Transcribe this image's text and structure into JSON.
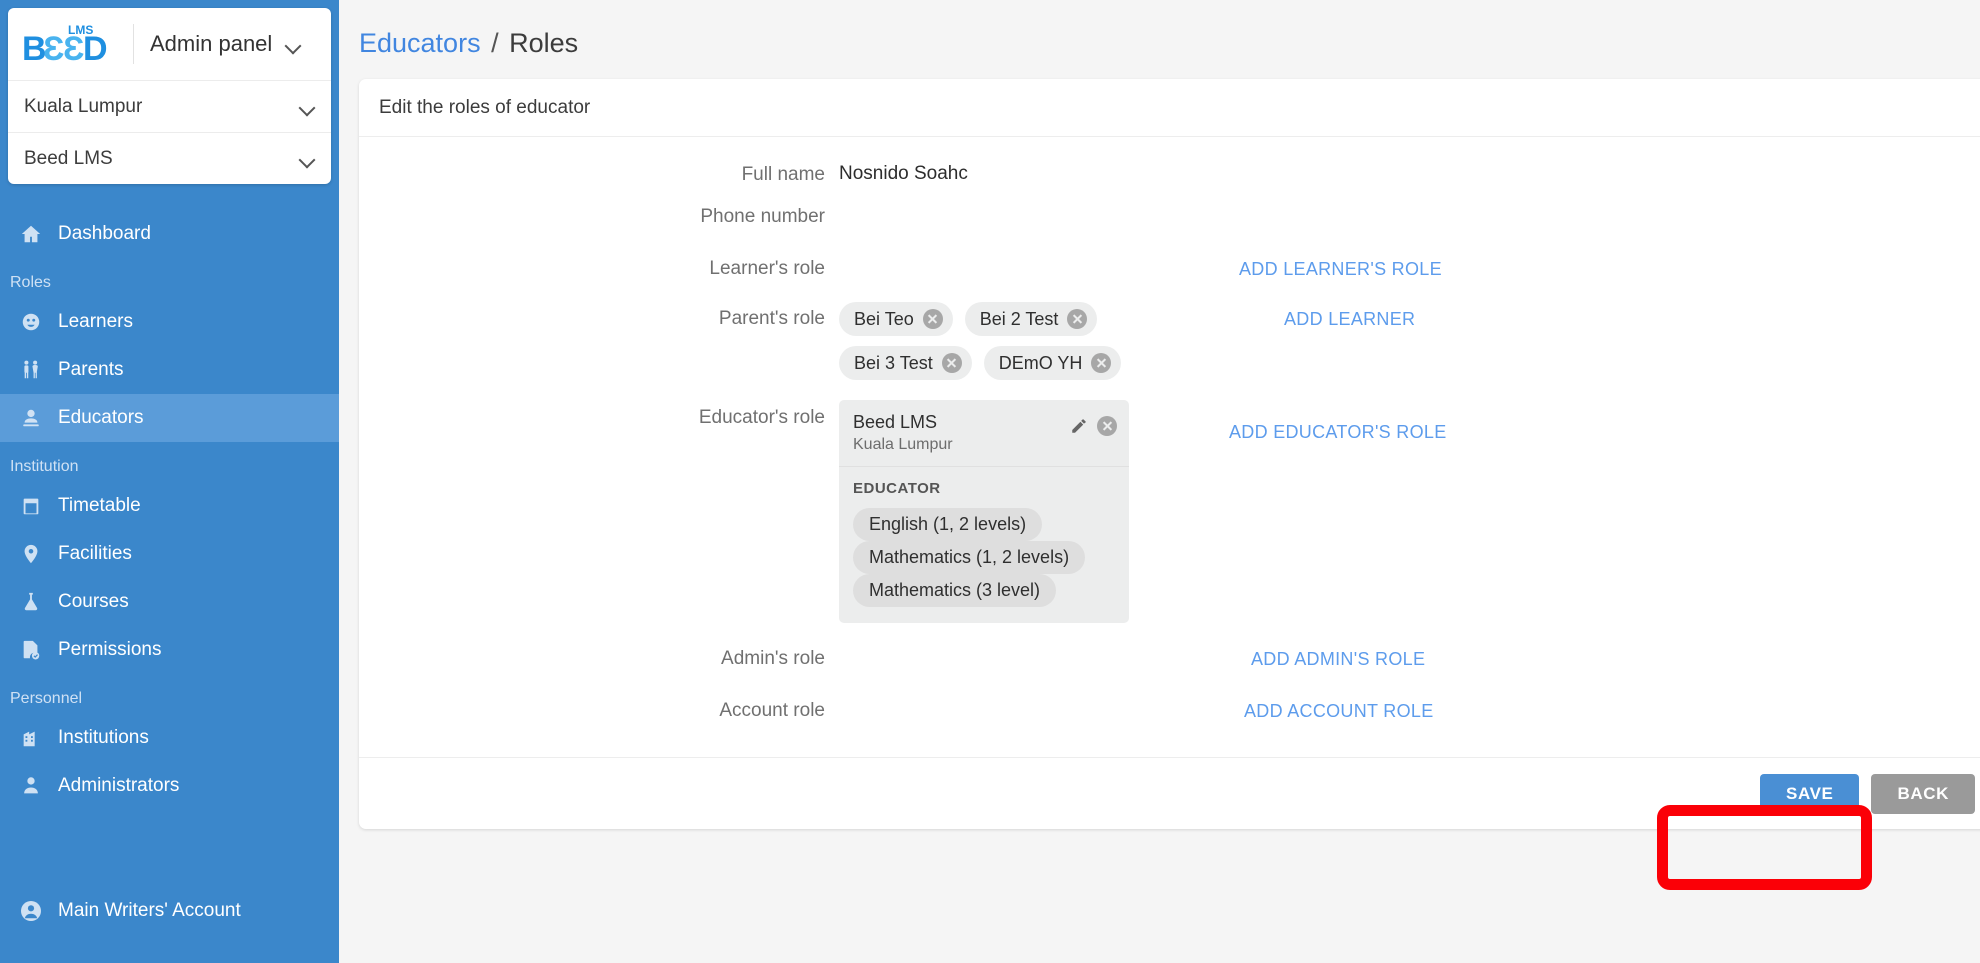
{
  "sidebar": {
    "logo_text": "BEED",
    "logo_superscript": "LMS",
    "admin_panel_label": "Admin panel",
    "selectors": [
      {
        "label": "Kuala Lumpur",
        "icon": "chevron-down-icon"
      },
      {
        "label": "Beed LMS",
        "icon": "chevron-down-icon"
      }
    ],
    "nav": [
      {
        "type": "item",
        "label": "Dashboard",
        "icon": "home-icon",
        "active": false
      },
      {
        "type": "section",
        "label": "Roles"
      },
      {
        "type": "item",
        "label": "Learners",
        "icon": "learner-face-icon",
        "active": false
      },
      {
        "type": "item",
        "label": "Parents",
        "icon": "parents-icon",
        "active": false
      },
      {
        "type": "item",
        "label": "Educators",
        "icon": "educator-icon",
        "active": true
      },
      {
        "type": "section",
        "label": "Institution"
      },
      {
        "type": "item",
        "label": "Timetable",
        "icon": "calendar-icon",
        "active": false
      },
      {
        "type": "item",
        "label": "Facilities",
        "icon": "map-pin-icon",
        "active": false
      },
      {
        "type": "item",
        "label": "Courses",
        "icon": "flask-icon",
        "active": false
      },
      {
        "type": "item",
        "label": "Permissions",
        "icon": "document-check-icon",
        "active": false
      },
      {
        "type": "section",
        "label": "Personnel"
      },
      {
        "type": "item",
        "label": "Institutions",
        "icon": "building-icon",
        "active": false
      },
      {
        "type": "item",
        "label": "Administrators",
        "icon": "person-icon",
        "active": false
      }
    ],
    "footer": {
      "label": "Main Writers' Account",
      "icon": "account-circle-icon"
    }
  },
  "breadcrumb": {
    "parent": "Educators",
    "separator": "/",
    "current": "Roles"
  },
  "card": {
    "header": "Edit the roles of educator",
    "rows": {
      "full_name": {
        "label": "Full name",
        "value": "Nosnido Soahc"
      },
      "phone_number": {
        "label": "Phone number",
        "value": ""
      },
      "learner_role": {
        "label": "Learner's role",
        "action": "ADD LEARNER'S ROLE"
      },
      "parent_role": {
        "label": "Parent's role",
        "action": "ADD LEARNER",
        "chips": [
          {
            "label": "Bei Teo",
            "remove_icon": "close-circle-icon"
          },
          {
            "label": "Bei 2 Test",
            "remove_icon": "close-circle-icon"
          },
          {
            "label": "Bei 3 Test",
            "remove_icon": "close-circle-icon"
          },
          {
            "label": "DEmO YH",
            "remove_icon": "close-circle-icon"
          }
        ]
      },
      "educator_role": {
        "label": "Educator's role",
        "action": "ADD EDUCATOR'S ROLE",
        "institution": {
          "name": "Beed LMS",
          "branch": "Kuala Lumpur",
          "edit_icon": "pencil-icon",
          "remove_icon": "close-circle-icon"
        },
        "section_title": "EDUCATOR",
        "subjects": [
          "English (1, 2 levels)",
          "Mathematics (1, 2 levels)",
          "Mathematics (3 level)"
        ]
      },
      "admin_role": {
        "label": "Admin's role",
        "action": "ADD ADMIN'S ROLE"
      },
      "account_role": {
        "label": "Account role",
        "action": "ADD ACCOUNT ROLE"
      }
    },
    "footer": {
      "save_label": "SAVE",
      "back_label": "BACK"
    }
  },
  "colors": {
    "sidebar_bg": "#3b87cb",
    "sidebar_active": "#5b9cd9",
    "link_blue": "#5d9cec",
    "breadcrumb_link": "#4186e0",
    "save_button": "#4a8fd4",
    "back_button": "#9a9a9a",
    "annotation_red": "#fb0007",
    "chip_bg": "#eceded"
  },
  "annotation": {
    "shape": "rounded-rectangle",
    "color": "#fb0007",
    "target": "save-button"
  }
}
